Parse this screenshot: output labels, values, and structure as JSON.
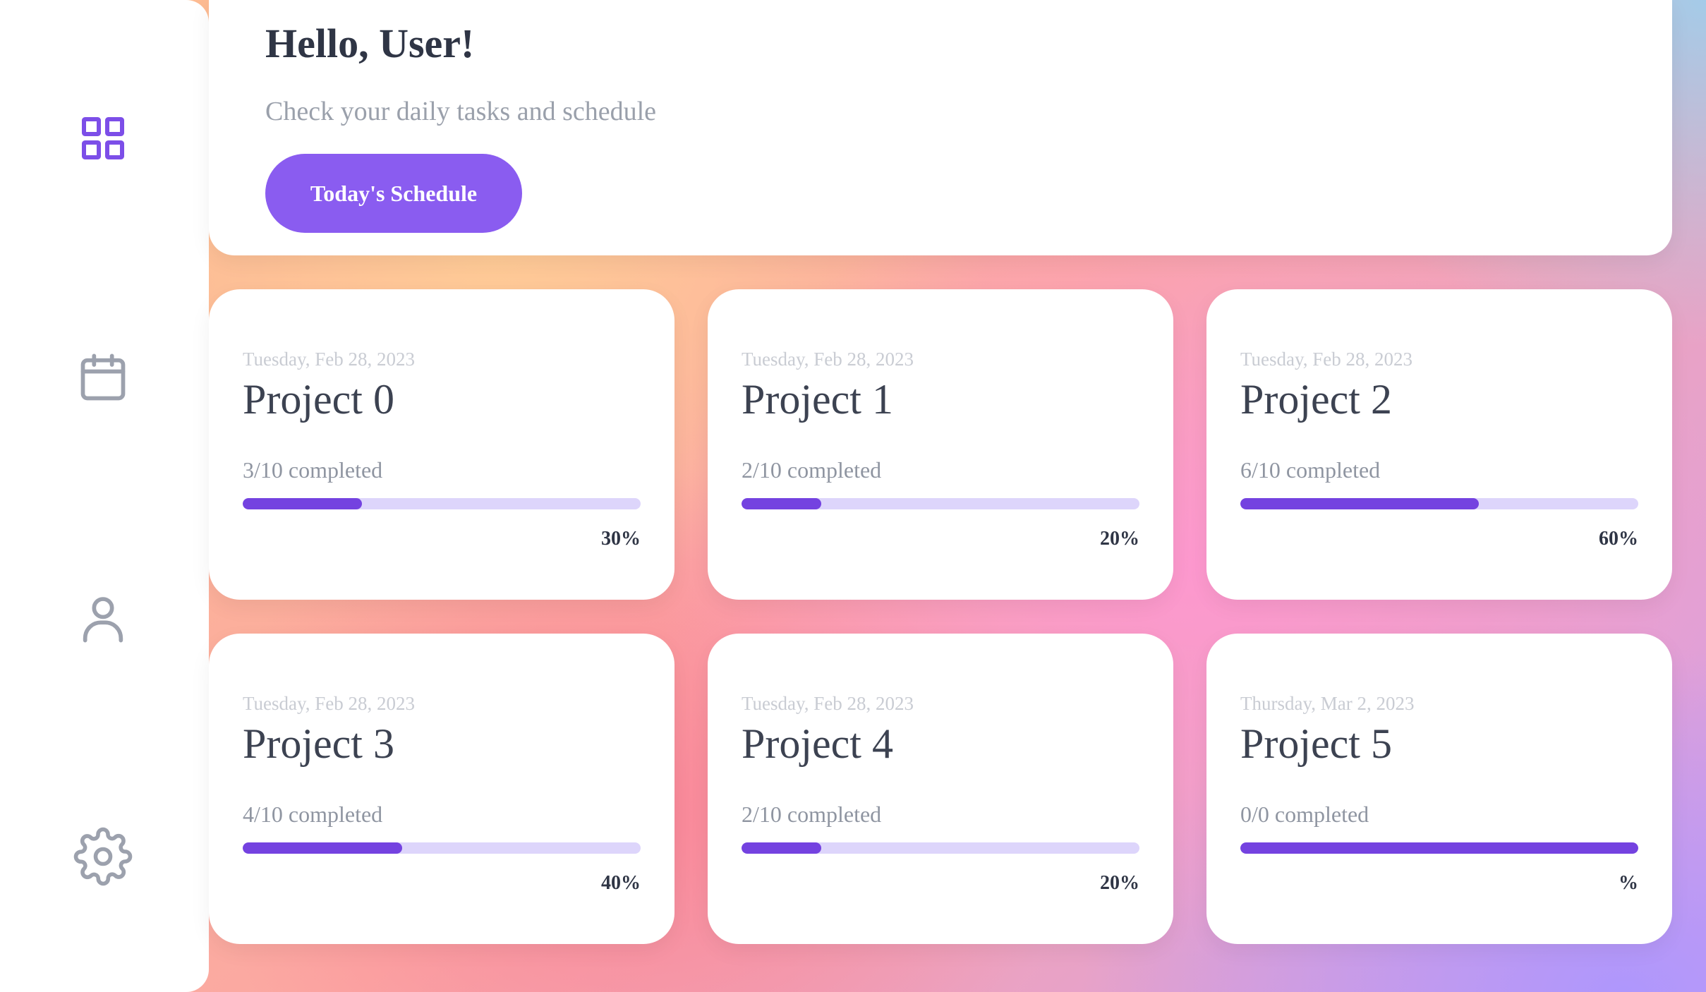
{
  "sidebar": {
    "items": [
      {
        "name": "dashboard",
        "icon": "grid-icon",
        "active": true
      },
      {
        "name": "calendar",
        "icon": "calendar-icon",
        "active": false
      },
      {
        "name": "profile",
        "icon": "user-icon",
        "active": false
      },
      {
        "name": "settings",
        "icon": "gear-icon",
        "active": false
      }
    ],
    "active_color": "#7c4ee8",
    "inactive_color": "#9ca1ad"
  },
  "header": {
    "greeting": "Hello, User!",
    "subtitle": "Check your daily tasks and schedule",
    "button_label": "Today's Schedule"
  },
  "colors": {
    "accent": "#8a5cf0",
    "progress_fill": "#7442e0",
    "progress_track": "#ddd5fb"
  },
  "projects": [
    {
      "date": "Tuesday, Feb 28, 2023",
      "title": "Project 0",
      "completed": "3/10 completed",
      "progress": 0.3,
      "percent": "30%"
    },
    {
      "date": "Tuesday, Feb 28, 2023",
      "title": "Project 1",
      "completed": "2/10 completed",
      "progress": 0.2,
      "percent": "20%"
    },
    {
      "date": "Tuesday, Feb 28, 2023",
      "title": "Project 2",
      "completed": "6/10 completed",
      "progress": 0.6,
      "percent": "60%"
    },
    {
      "date": "Tuesday, Feb 28, 2023",
      "title": "Project 3",
      "completed": "4/10 completed",
      "progress": 0.4,
      "percent": "40%"
    },
    {
      "date": "Tuesday, Feb 28, 2023",
      "title": "Project 4",
      "completed": "2/10 completed",
      "progress": 0.2,
      "percent": "20%"
    },
    {
      "date": "Thursday, Mar 2, 2023",
      "title": "Project 5",
      "completed": "0/0 completed",
      "progress": 1.0,
      "percent": "%"
    }
  ]
}
